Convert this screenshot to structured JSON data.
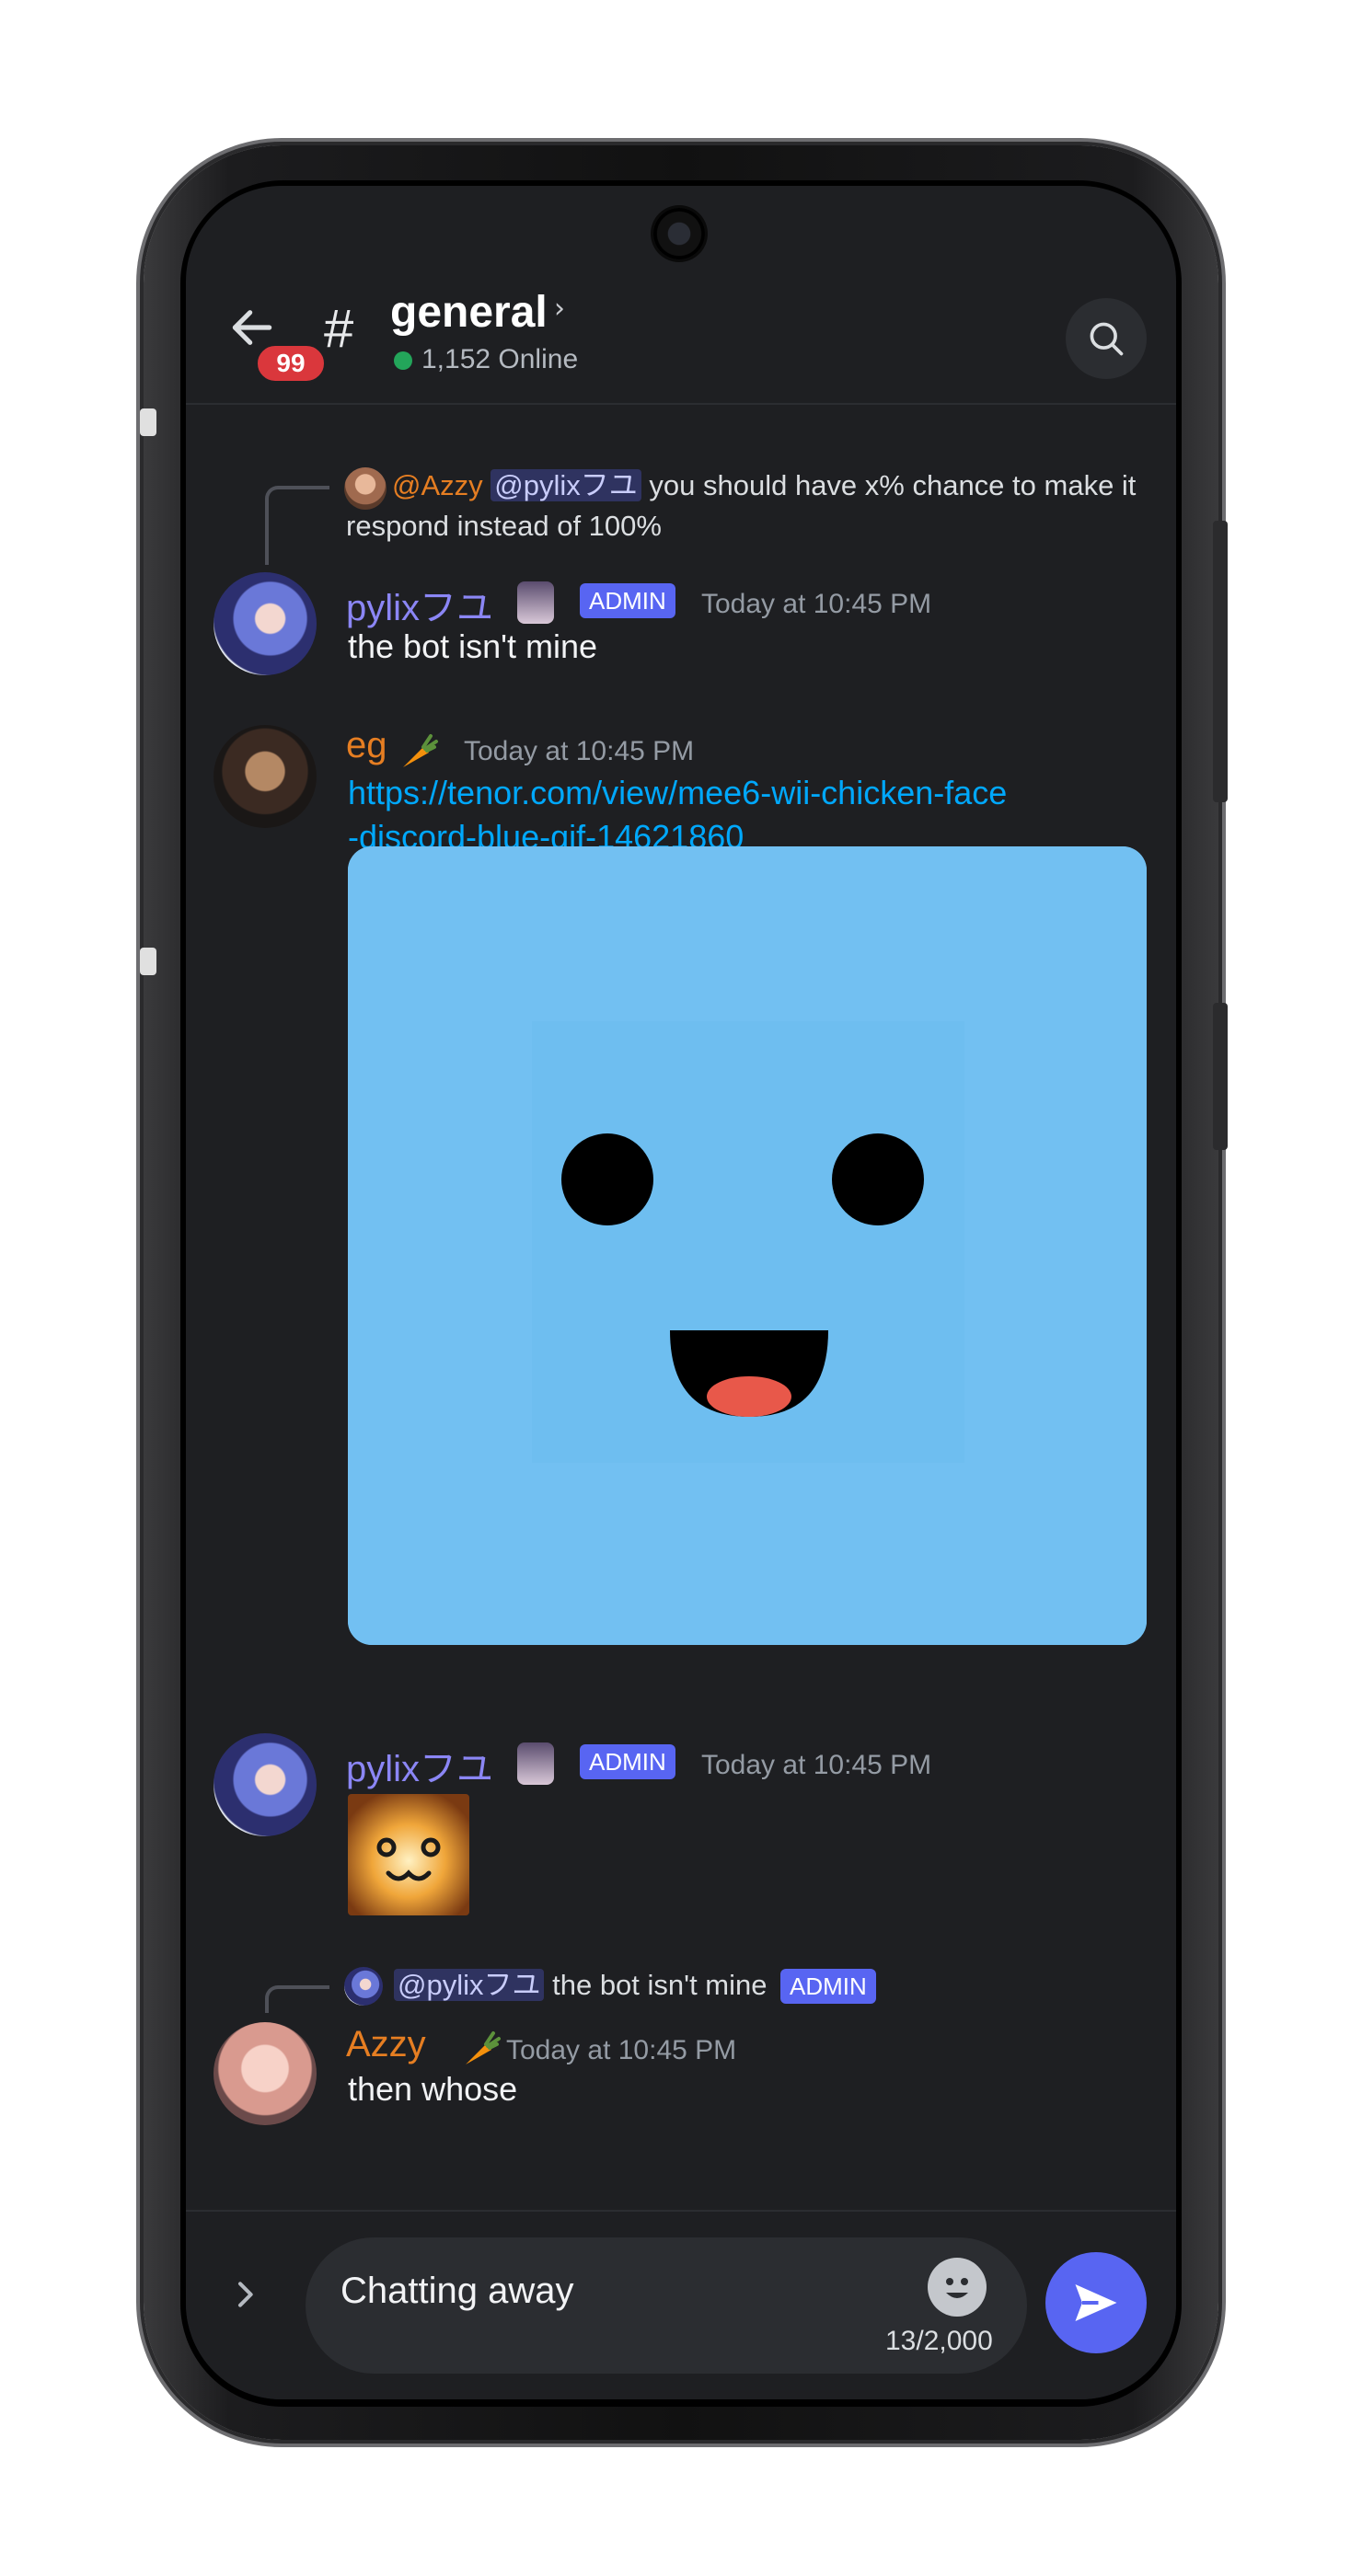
{
  "header": {
    "back_badge": "99",
    "channel_hash": "#",
    "channel_name": "general",
    "online_text": "1,152 Online"
  },
  "messages": [
    {
      "reply": {
        "author": "@Azzy",
        "mention": "@pylixフユ",
        "text_line1": "you should have x% chance to make it",
        "text_line2": "respond instead of 100%"
      },
      "author": "pylixフユ",
      "badge": "ADMIN",
      "time": "Today at 10:45 PM",
      "text": "the bot isn't mine"
    },
    {
      "author": "eg",
      "time": "Today at 10:45 PM",
      "link_line1": "https://tenor.com/view/mee6-wii-chicken-face",
      "link_line2": "-discord-blue-gif-14621860"
    },
    {
      "author": "pylixフユ",
      "badge": "ADMIN",
      "time": "Today at 10:45 PM"
    },
    {
      "reply": {
        "mention": "@pylixフユ",
        "text": "the bot isn't mine",
        "badge": "ADMIN"
      },
      "author": "Azzy",
      "time": "Today at 10:45 PM",
      "text": "then whose"
    }
  ],
  "composer": {
    "value": "Chatting away",
    "counter": "13/2,000"
  },
  "colors": {
    "background": "#1e1f22",
    "blurple": "#5865f2",
    "admin_name": "#8b86f5",
    "orange_name": "#e67e22",
    "link": "#00a8fc",
    "gif_blue": "#72c0f2",
    "badge_red": "#da373c"
  }
}
